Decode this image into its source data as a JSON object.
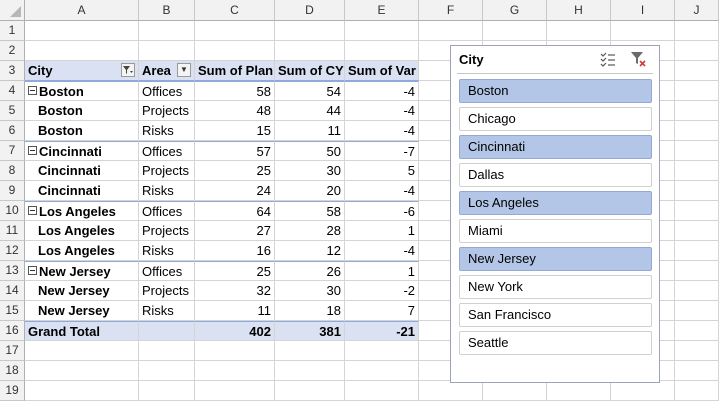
{
  "columns": [
    "A",
    "B",
    "C",
    "D",
    "E",
    "F",
    "G",
    "H",
    "I",
    "J"
  ],
  "row_numbers": [
    "1",
    "2",
    "3",
    "4",
    "5",
    "6",
    "7",
    "8",
    "9",
    "10",
    "11",
    "12",
    "13",
    "14",
    "15",
    "16",
    "17",
    "18",
    "19"
  ],
  "pivot": {
    "headers": {
      "city": "City",
      "area": "Area",
      "plan": "Sum of Plan",
      "cy": "Sum of CY",
      "var": "Sum of Var"
    },
    "rows": [
      {
        "city": "Boston",
        "area": "Offices",
        "plan": "58",
        "cy": "54",
        "var": "-4"
      },
      {
        "city": "Boston",
        "area": "Projects",
        "plan": "48",
        "cy": "44",
        "var": "-4"
      },
      {
        "city": "Boston",
        "area": "Risks",
        "plan": "15",
        "cy": "11",
        "var": "-4"
      },
      {
        "city": "Cincinnati",
        "area": "Offices",
        "plan": "57",
        "cy": "50",
        "var": "-7"
      },
      {
        "city": "Cincinnati",
        "area": "Projects",
        "plan": "25",
        "cy": "30",
        "var": "5"
      },
      {
        "city": "Cincinnati",
        "area": "Risks",
        "plan": "24",
        "cy": "20",
        "var": "-4"
      },
      {
        "city": "Los Angeles",
        "area": "Offices",
        "plan": "64",
        "cy": "58",
        "var": "-6"
      },
      {
        "city": "Los Angeles",
        "area": "Projects",
        "plan": "27",
        "cy": "28",
        "var": "1"
      },
      {
        "city": "Los Angeles",
        "area": "Risks",
        "plan": "16",
        "cy": "12",
        "var": "-4"
      },
      {
        "city": "New Jersey",
        "area": "Offices",
        "plan": "25",
        "cy": "26",
        "var": "1"
      },
      {
        "city": "New Jersey",
        "area": "Projects",
        "plan": "32",
        "cy": "30",
        "var": "-2"
      },
      {
        "city": "New Jersey",
        "area": "Risks",
        "plan": "11",
        "cy": "18",
        "var": "7"
      }
    ],
    "grand_total": {
      "label": "Grand Total",
      "plan": "402",
      "cy": "381",
      "var": "-21"
    }
  },
  "slicer": {
    "title": "City",
    "items": [
      {
        "label": "Boston",
        "selected": true
      },
      {
        "label": "Chicago",
        "selected": false
      },
      {
        "label": "Cincinnati",
        "selected": true
      },
      {
        "label": "Dallas",
        "selected": false
      },
      {
        "label": "Los Angeles",
        "selected": true
      },
      {
        "label": "Miami",
        "selected": false
      },
      {
        "label": "New Jersey",
        "selected": true
      },
      {
        "label": "New York",
        "selected": false
      },
      {
        "label": "San Francisco",
        "selected": false
      },
      {
        "label": "Seattle",
        "selected": false
      }
    ]
  },
  "colors": {
    "pivot_header_bg": "#d9e1f2",
    "slicer_selected": "#b4c6e7"
  }
}
